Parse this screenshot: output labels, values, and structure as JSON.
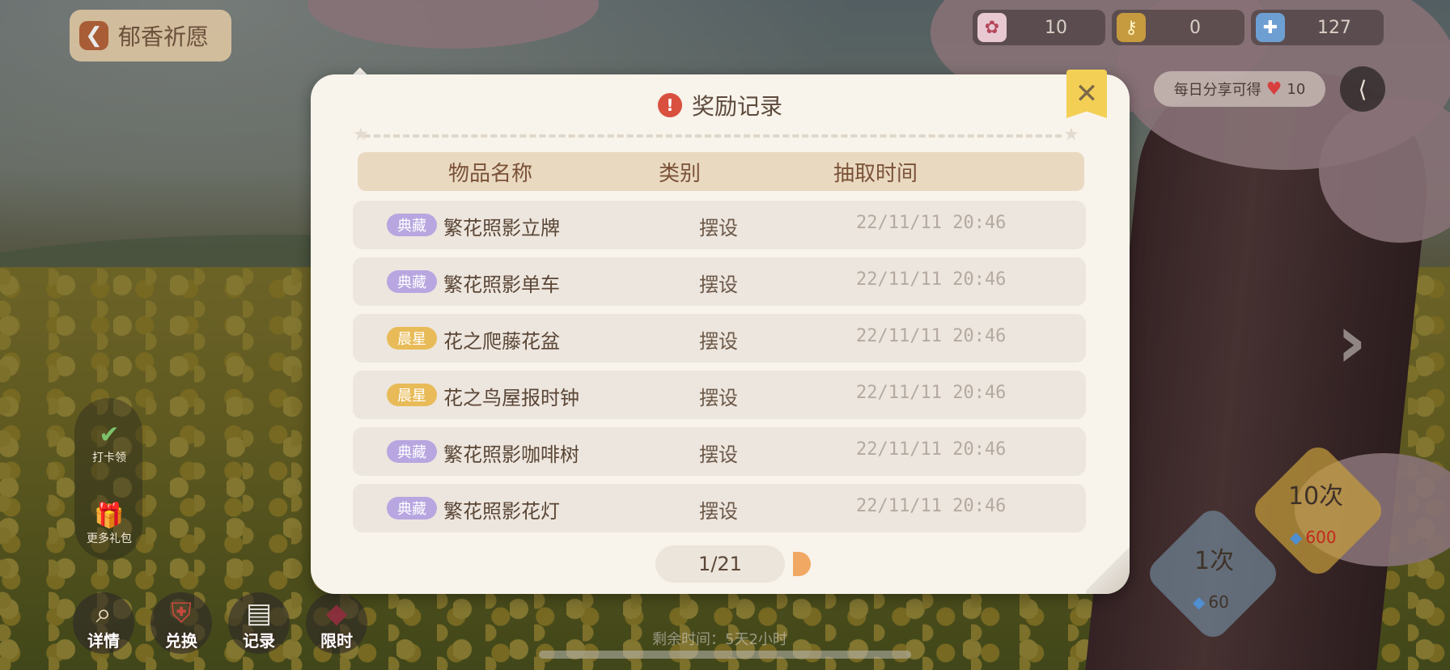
{
  "header": {
    "back_title": "郁香祈愿"
  },
  "currencies": [
    {
      "icon": "sakura-ticket-icon",
      "value": "10"
    },
    {
      "icon": "key-icon",
      "value": "0"
    },
    {
      "icon": "crystal-plus-icon",
      "value": "127"
    }
  ],
  "share": {
    "label": "每日分享可得",
    "amount": "10"
  },
  "side": {
    "check_label": "打卡领",
    "gift_label": "更多礼包"
  },
  "bottom_nav": [
    {
      "label": "详情",
      "icon": "magnifier-icon"
    },
    {
      "label": "兑换",
      "icon": "exchange-icon"
    },
    {
      "label": "记录",
      "icon": "record-icon"
    },
    {
      "label": "限时",
      "icon": "limited-icon"
    }
  ],
  "remaining": "剩余时间：5天2小时",
  "draw": {
    "once_label": "1次",
    "once_cost": "60",
    "ten_label": "10次",
    "ten_cost": "600"
  },
  "modal": {
    "title": "奖励记录",
    "columns": [
      "物品名称",
      "类别",
      "抽取时间"
    ],
    "rows": [
      {
        "rarity": "典藏",
        "rarity_type": "dc",
        "name": "繁花照影立牌",
        "category": "摆设",
        "time": "22/11/11 20:46"
      },
      {
        "rarity": "典藏",
        "rarity_type": "dc",
        "name": "繁花照影单车",
        "category": "摆设",
        "time": "22/11/11 20:46"
      },
      {
        "rarity": "晨星",
        "rarity_type": "cx",
        "name": "花之爬藤花盆",
        "category": "摆设",
        "time": "22/11/11 20:46"
      },
      {
        "rarity": "晨星",
        "rarity_type": "cx",
        "name": "花之鸟屋报时钟",
        "category": "摆设",
        "time": "22/11/11 20:46"
      },
      {
        "rarity": "典藏",
        "rarity_type": "dc",
        "name": "繁花照影咖啡树",
        "category": "摆设",
        "time": "22/11/11 20:46"
      },
      {
        "rarity": "典藏",
        "rarity_type": "dc",
        "name": "繁花照影花灯",
        "category": "摆设",
        "time": "22/11/11 20:46"
      }
    ],
    "page": "1/21"
  },
  "colors": {
    "accent": "#f3cf55",
    "rarity_dc": "#b7a6e0",
    "rarity_cx": "#e8bb58",
    "alert": "#d9503f"
  }
}
